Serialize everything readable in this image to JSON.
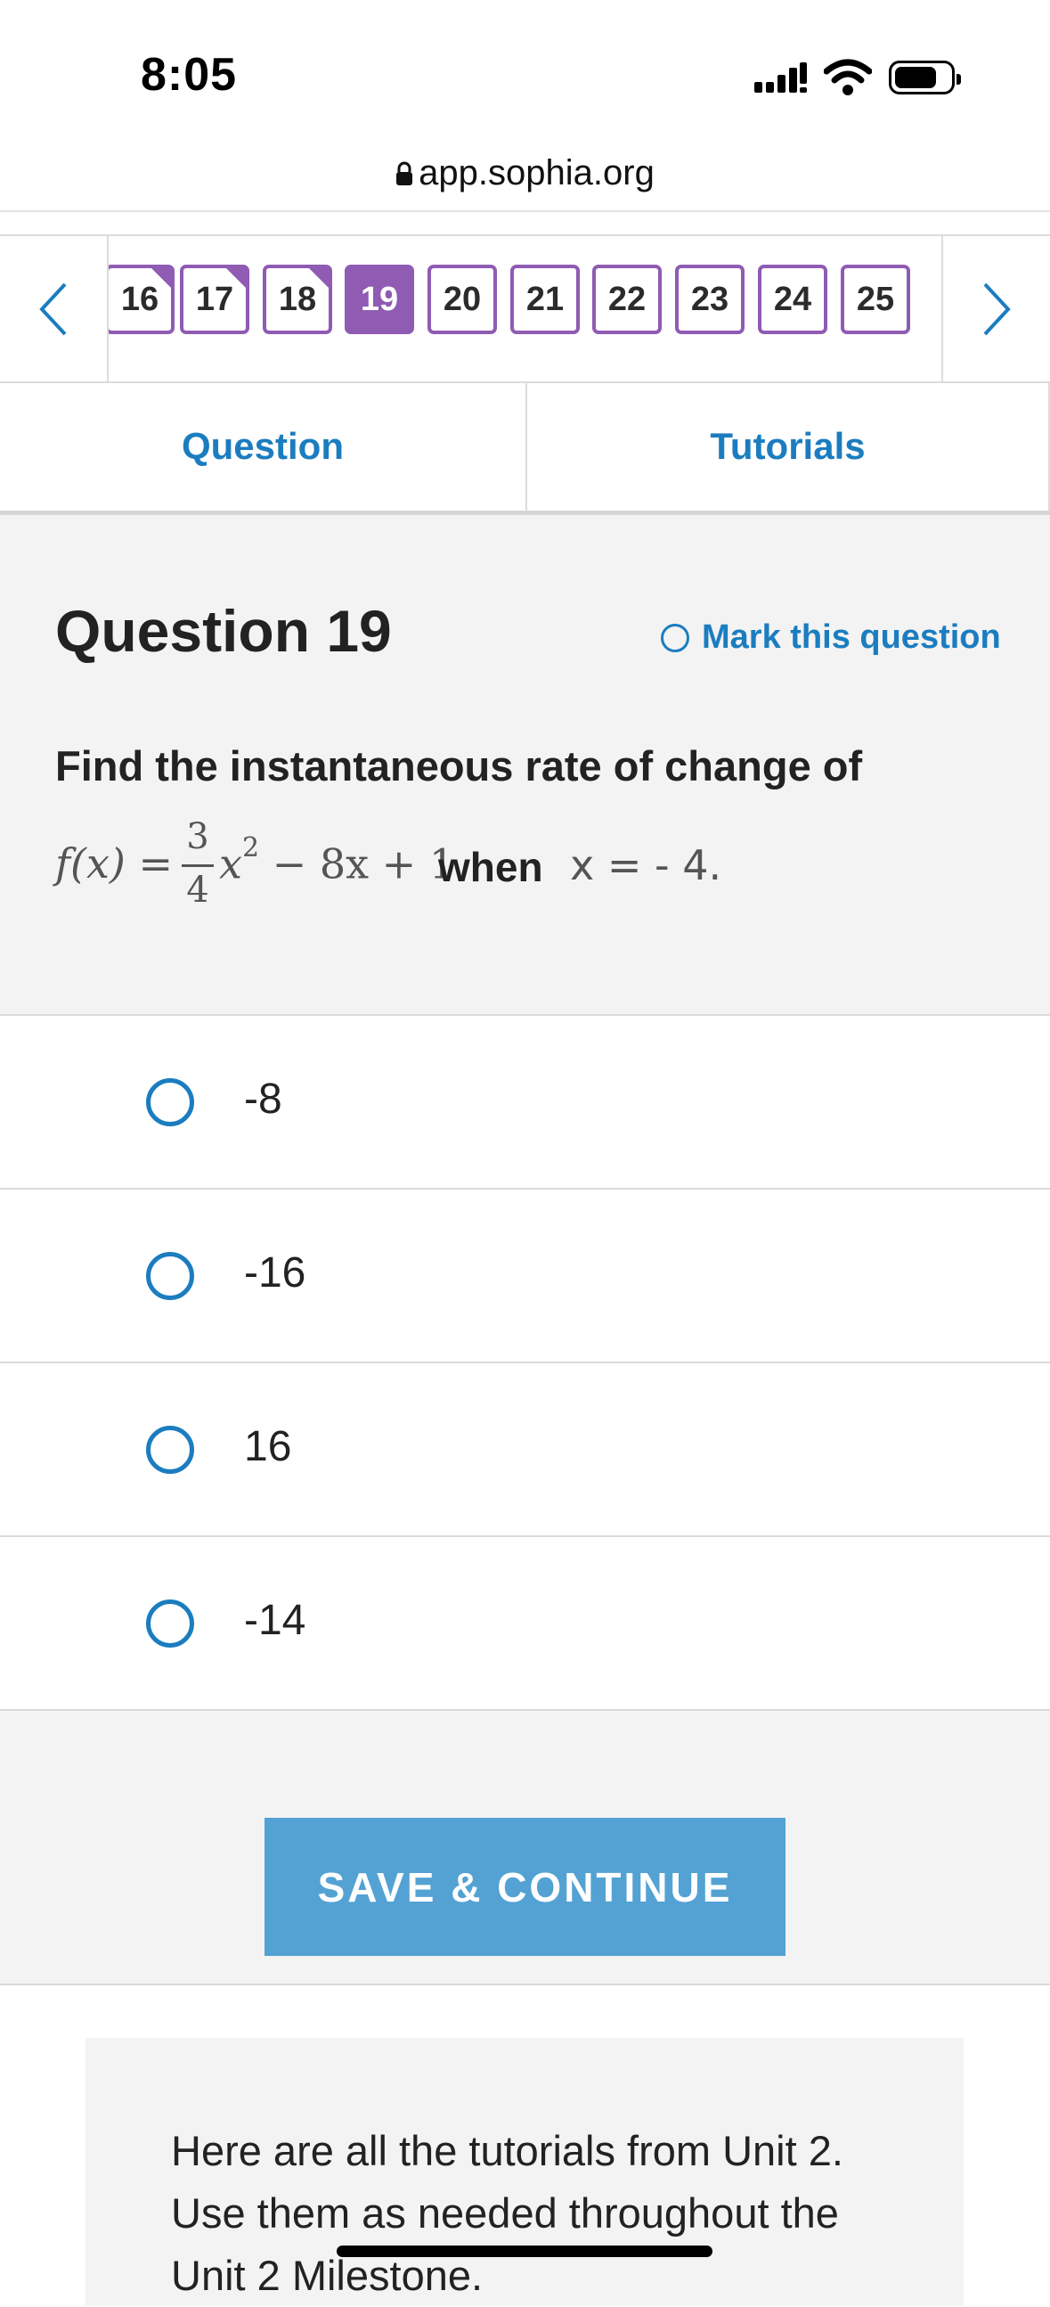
{
  "status_bar": {
    "time": "8:05"
  },
  "browser": {
    "url": "app.sophia.org"
  },
  "question_nav": {
    "items": [
      {
        "label": "16",
        "state": "answered"
      },
      {
        "label": "17",
        "state": "answered"
      },
      {
        "label": "18",
        "state": "answered"
      },
      {
        "label": "19",
        "state": "current"
      },
      {
        "label": "20",
        "state": "unanswered"
      },
      {
        "label": "21",
        "state": "unanswered"
      },
      {
        "label": "22",
        "state": "unanswered"
      },
      {
        "label": "23",
        "state": "unanswered"
      },
      {
        "label": "24",
        "state": "unanswered"
      },
      {
        "label": "25",
        "state": "unanswered"
      }
    ]
  },
  "tabs": {
    "question": "Question",
    "tutorials": "Tutorials"
  },
  "question": {
    "title": "Question 19",
    "mark_label": "Mark this question",
    "prompt": "Find the instantaneous rate of change of",
    "math": {
      "lhs": "f(x) =",
      "frac_num": "3",
      "frac_den": "4",
      "rest": "x",
      "exp": "2",
      "tail": " − 8x + 1",
      "when": "when",
      "condition": "x  =  - 4."
    }
  },
  "options": [
    "-8",
    "-16",
    "16",
    "-14"
  ],
  "save_button": "SAVE & CONTINUE",
  "tutorials_card": {
    "text": "Here are all the tutorials from Unit 2. Use them as needed throughout the Unit 2 Milestone."
  },
  "colors": {
    "accent": "#1b7dbf",
    "chip": "#8f5bb3",
    "save": "#54a2d4"
  }
}
